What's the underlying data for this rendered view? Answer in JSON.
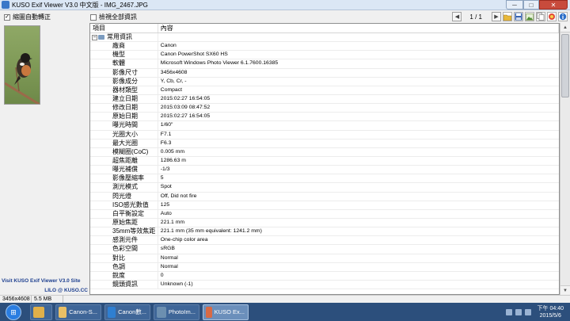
{
  "window": {
    "title": "KUSO Exif Viewer V3.0 中文版 - IMG_2467.JPG",
    "min": "─",
    "max": "□",
    "close": "✕"
  },
  "toolbar": {
    "auto_rotate_label": "縮圖自動轉正",
    "auto_rotate_checked": "✓",
    "show_all_label": "檢視全部資訊",
    "prev": "◀",
    "pager": "1 / 1",
    "next": "▶"
  },
  "grid": {
    "header_item": "項目",
    "header_value": "內容",
    "group_label": "常用資訊",
    "expander": "−",
    "rows": [
      {
        "k": "廠商",
        "v": "Canon"
      },
      {
        "k": "機型",
        "v": "Canon PowerShot SX60 HS"
      },
      {
        "k": "軟體",
        "v": "Microsoft Windows Photo Viewer 6.1.7600.16385"
      },
      {
        "k": "影像尺寸",
        "v": "3456x4608"
      },
      {
        "k": "影像成分",
        "v": "Y, Cb, Cr, -"
      },
      {
        "k": "器材類型",
        "v": "Compact"
      },
      {
        "k": "建立日期",
        "v": "2015:02:27 16:54:05"
      },
      {
        "k": "修改日期",
        "v": "2015:03:09 08:47:52"
      },
      {
        "k": "原始日期",
        "v": "2015:02:27 16:54:05"
      },
      {
        "k": "曝光時間",
        "v": "1/60\""
      },
      {
        "k": "光圈大小",
        "v": "F7.1"
      },
      {
        "k": "最大光圈",
        "v": "F6.3"
      },
      {
        "k": "模糊圈(CoC)",
        "v": "0.005 mm"
      },
      {
        "k": "超焦距離",
        "v": "1286.63 m"
      },
      {
        "k": "曝光補償",
        "v": "-1/3"
      },
      {
        "k": "影像壓縮率",
        "v": "5"
      },
      {
        "k": "測光模式",
        "v": "Spot"
      },
      {
        "k": "閃光燈",
        "v": "Off, Did not fire"
      },
      {
        "k": "ISO感光數值",
        "v": "125"
      },
      {
        "k": "白平衡設定",
        "v": "Auto"
      },
      {
        "k": "原始焦距",
        "v": "221.1 mm"
      },
      {
        "k": "35mm等效焦距",
        "v": "221.1 mm (35 mm equivalent: 1241.2 mm)"
      },
      {
        "k": "感測元件",
        "v": "One-chip color area"
      },
      {
        "k": "色彩空間",
        "v": "sRGB"
      },
      {
        "k": "對比",
        "v": "Normal"
      },
      {
        "k": "色調",
        "v": "Normal"
      },
      {
        "k": "銳度",
        "v": "0"
      },
      {
        "k": "鏡頭資訊",
        "v": "Unknown (-1)"
      }
    ]
  },
  "sidebar": {
    "visit_text": "Visit KUSO Exif Viewer V3.0 Site",
    "lilo_text": "LILO @ KUSO.CC"
  },
  "status": {
    "dimensions": "3456x4608",
    "filesize": "5.5 MB"
  },
  "taskbar": {
    "start_glyph": "⊞",
    "tasks": [
      {
        "label": "",
        "color": "#e0b04a"
      },
      {
        "label": "Canon-S...",
        "color": "#e9c066"
      },
      {
        "label": "Canon數...",
        "color": "#2f7fd1"
      },
      {
        "label": "PhotoIm...",
        "color": "#6c8fb0"
      },
      {
        "label": "KUSO Ex...",
        "color": "#d86a45"
      }
    ],
    "clock_time": "下午 04:40",
    "clock_date": "2015/5/6"
  },
  "colors": {
    "link": "#1d3f8f",
    "taskbar": "#2c4f7c"
  }
}
